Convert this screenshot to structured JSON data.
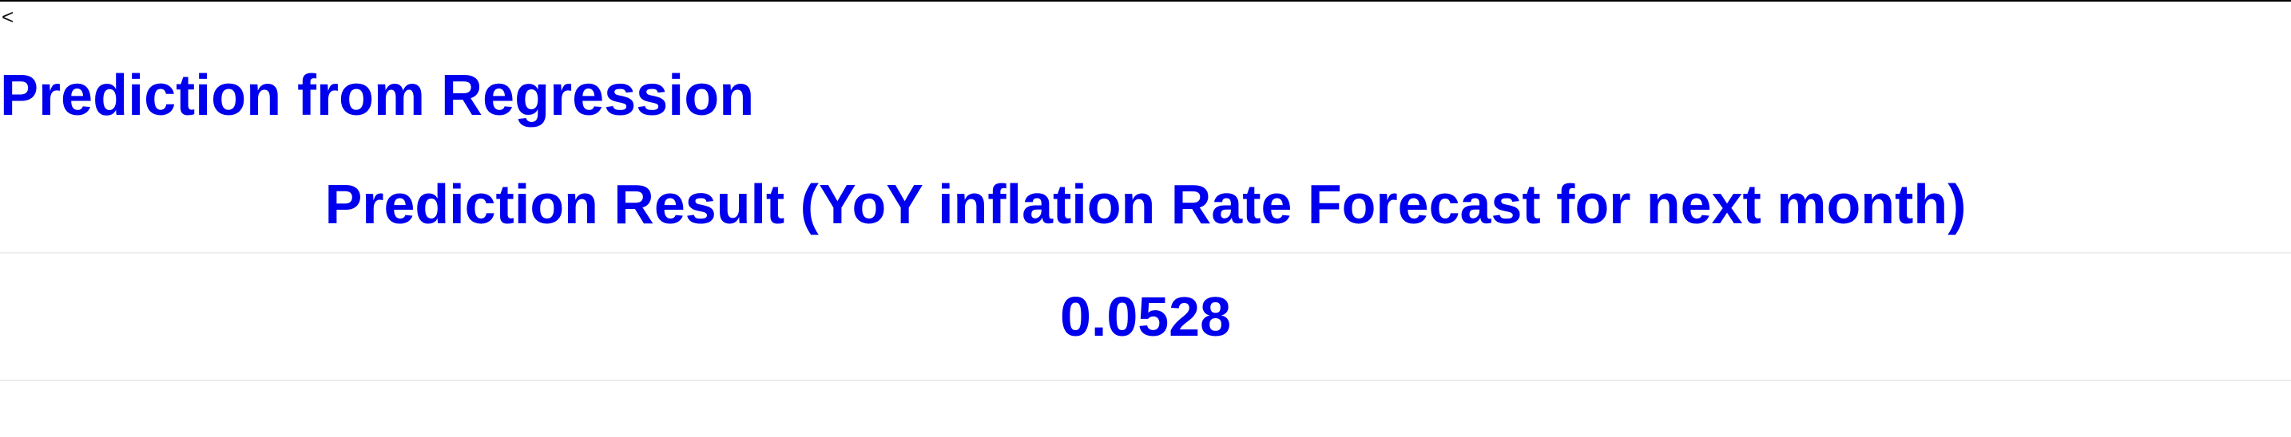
{
  "nav": {
    "back_label": "<"
  },
  "page": {
    "title": "Prediction from Regression"
  },
  "result": {
    "header": "Prediction Result (YoY inflation Rate Forecast for next month)",
    "value": "0.0528"
  },
  "colors": {
    "accent": "#0000ee",
    "divider": "#ececec"
  }
}
